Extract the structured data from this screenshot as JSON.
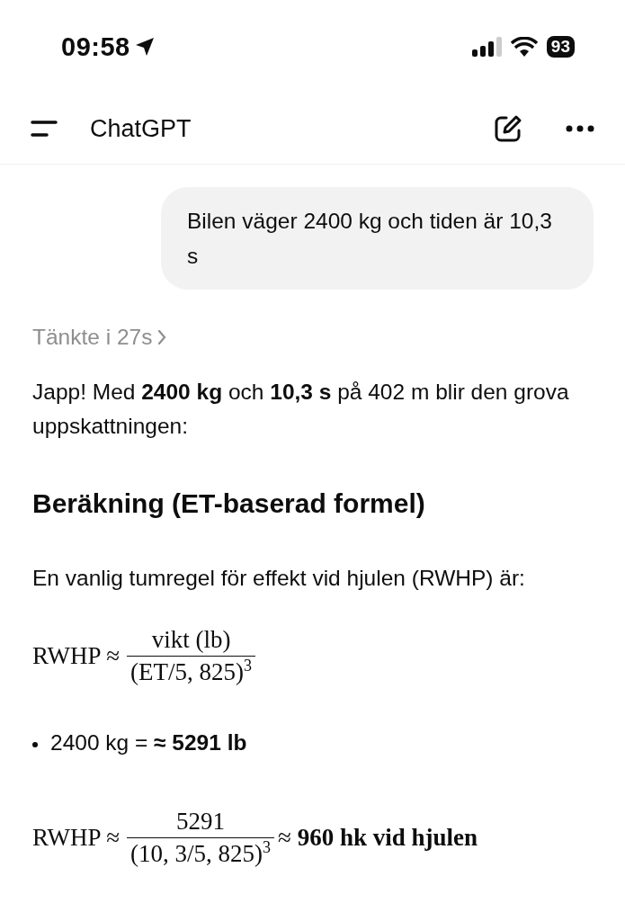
{
  "status_bar": {
    "time": "09:58",
    "battery": "93"
  },
  "header": {
    "title": "ChatGPT"
  },
  "messages": [
    {
      "kind": "user",
      "text": "Bilen väger 2400 kg och tiden är 10,3 s"
    }
  ],
  "response": {
    "thinking": "Tänkte i 27s",
    "blocks": [
      {
        "kind": "paragraph",
        "text": "Japp! Med **2400 kg** och **10,3 s** på 402 m blir den grova uppskattningen:"
      },
      {
        "kind": "heading",
        "text": "Beräkning (ET-baserad formel)"
      },
      {
        "kind": "paragraph",
        "text": "En vanlig tumregel för effekt vid hjulen (RWHP) är:"
      },
      {
        "kind": "formula",
        "lhs": "RWHP ≈",
        "numerator": "vikt (lb)",
        "denominator": "(ET/5, 825)$^{3}$"
      },
      {
        "kind": "bullet",
        "text": "2400 kg = **≈ 5291 lb**"
      },
      {
        "kind": "formula",
        "lhs": "RWHP ≈",
        "numerator": "5291",
        "denominator": "(10, 3/5, 825)$^{3}$",
        "result": "≈ **960 hk vid hjulen**"
      }
    ]
  }
}
